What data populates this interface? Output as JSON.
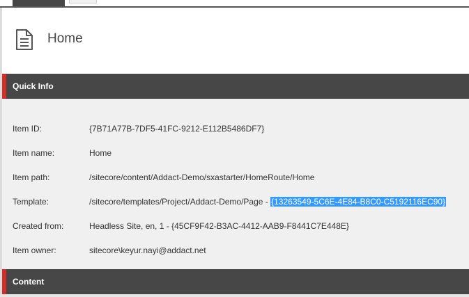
{
  "header": {
    "title": "Home",
    "icon": "document-icon"
  },
  "sections": {
    "quick_info": "Quick Info",
    "content": "Content"
  },
  "quick_info": {
    "item_id_label": "Item ID:",
    "item_id_value": "{7B71A77B-7DF5-41FC-9212-E112B5486DF7}",
    "item_name_label": "Item name:",
    "item_name_value": "Home",
    "item_path_label": "Item path:",
    "item_path_value": "/sitecore/content/Addact-Demo/sxastarter/HomeRoute/Home",
    "template_label": "Template:",
    "template_path": "/sitecore/templates/Project/Addact-Demo/Page - ",
    "template_id_selected": "{13263549-5C6E-4E84-B8C0-C5192116EC90}",
    "created_from_label": "Created from:",
    "created_from_value": "Headless Site, en, 1 - {45CF9F42-B3AC-4412-AAB9-F8441C7E448E}",
    "item_owner_label": "Item owner:",
    "item_owner_value": "sitecore\\keyur.nayi@addact.net"
  },
  "colors": {
    "section_bar": "#474747",
    "accent_red": "#d42d28",
    "info_bg": "#f0f0f0",
    "selection": "#3399ff"
  }
}
